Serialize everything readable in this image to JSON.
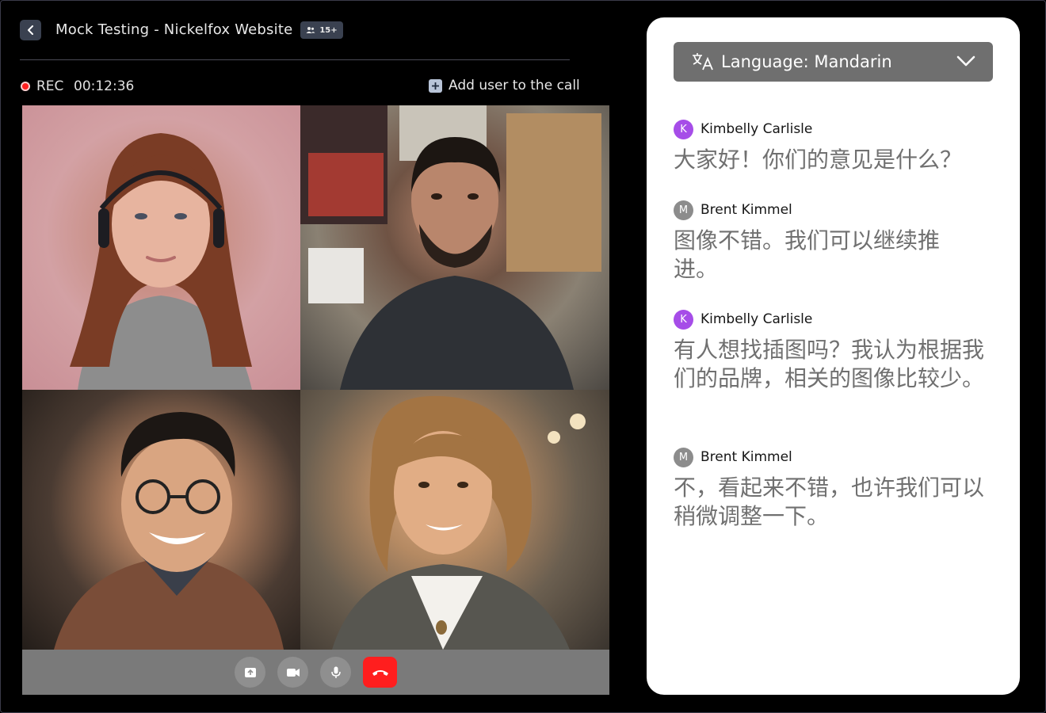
{
  "header": {
    "title": "Mock Testing - Nickelfox Website",
    "participants_badge": "15+"
  },
  "recording": {
    "label": "REC",
    "time": "00:12:36"
  },
  "add_user": {
    "label": "Add user to the call"
  },
  "controls": {
    "share": "share-screen-icon",
    "video": "video-camera-icon",
    "mic": "microphone-icon",
    "end": "end-call-icon",
    "end_color": "#ff1e1e"
  },
  "translation": {
    "language_label": "Language: Mandarin"
  },
  "messages": [
    {
      "initial": "K",
      "name": "Kimbelly Carlisle",
      "text": "大家好！你们的意见是什么？",
      "avatar_color": "#a64de8"
    },
    {
      "initial": "M",
      "name": "Brent Kimmel",
      "text": "图像不错。我们可以继续推进。",
      "avatar_color": "#8c8c8c"
    },
    {
      "initial": "K",
      "name": "Kimbelly Carlisle",
      "text": "有人想找插图吗？我认为根据我们的品牌，相关的图像比较少。",
      "avatar_color": "#a64de8"
    },
    {
      "initial": "M",
      "name": "Brent Kimmel",
      "text": "不，看起来不错，也许我们可以稍微调整一下。",
      "avatar_color": "#8c8c8c"
    }
  ]
}
